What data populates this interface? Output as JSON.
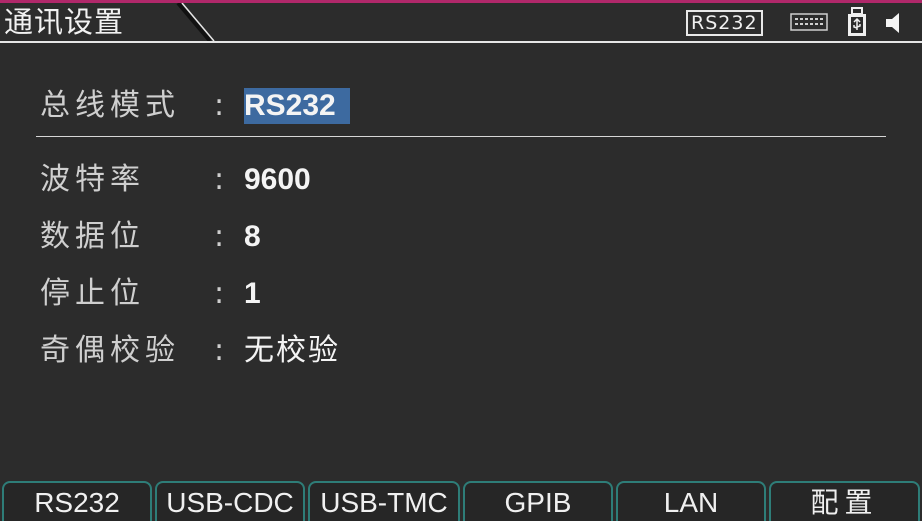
{
  "title_bar": {
    "title": "通讯设置",
    "interface_badge": "RS232",
    "icons": [
      "keyboard-icon",
      "usb-icon",
      "speaker-icon"
    ]
  },
  "settings": {
    "bus_mode": {
      "label": "总线模式",
      "colon": ":",
      "value": "RS232"
    },
    "baud_rate": {
      "label": "波特率",
      "colon": ":",
      "value": "9600"
    },
    "data_bits": {
      "label": "数据位",
      "colon": ":",
      "value": "8"
    },
    "stop_bits": {
      "label": "停止位",
      "colon": ":",
      "value": "1"
    },
    "parity": {
      "label": "奇偶校验",
      "colon": ":",
      "value": "无校验"
    }
  },
  "softkeys": [
    "RS232",
    "USB-CDC",
    "USB-TMC",
    "GPIB",
    "LAN",
    "配置"
  ],
  "colors": {
    "background": "#2c2c2c",
    "accent": "#b0286a",
    "selection": "#3d6aa0",
    "softkey_border": "#2e7d78"
  }
}
